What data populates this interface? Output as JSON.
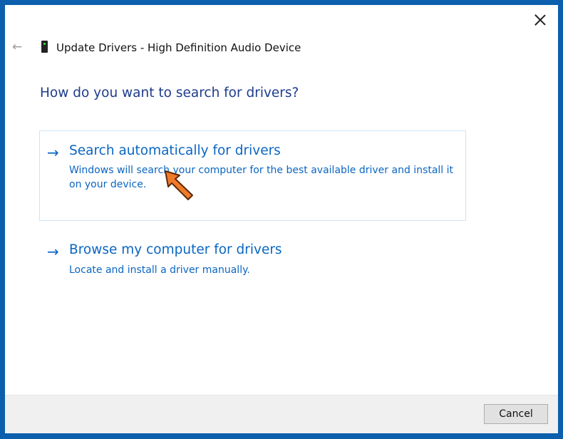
{
  "window": {
    "title": "Update Drivers - High Definition Audio Device"
  },
  "heading": "How do you want to search for drivers?",
  "options": [
    {
      "title": "Search automatically for drivers",
      "description": "Windows will search your computer for the best available driver and install it on your device."
    },
    {
      "title": "Browse my computer for drivers",
      "description": "Locate and install a driver manually."
    }
  ],
  "footer": {
    "cancel_label": "Cancel"
  },
  "icons": {
    "back": "←",
    "arrow": "→"
  }
}
